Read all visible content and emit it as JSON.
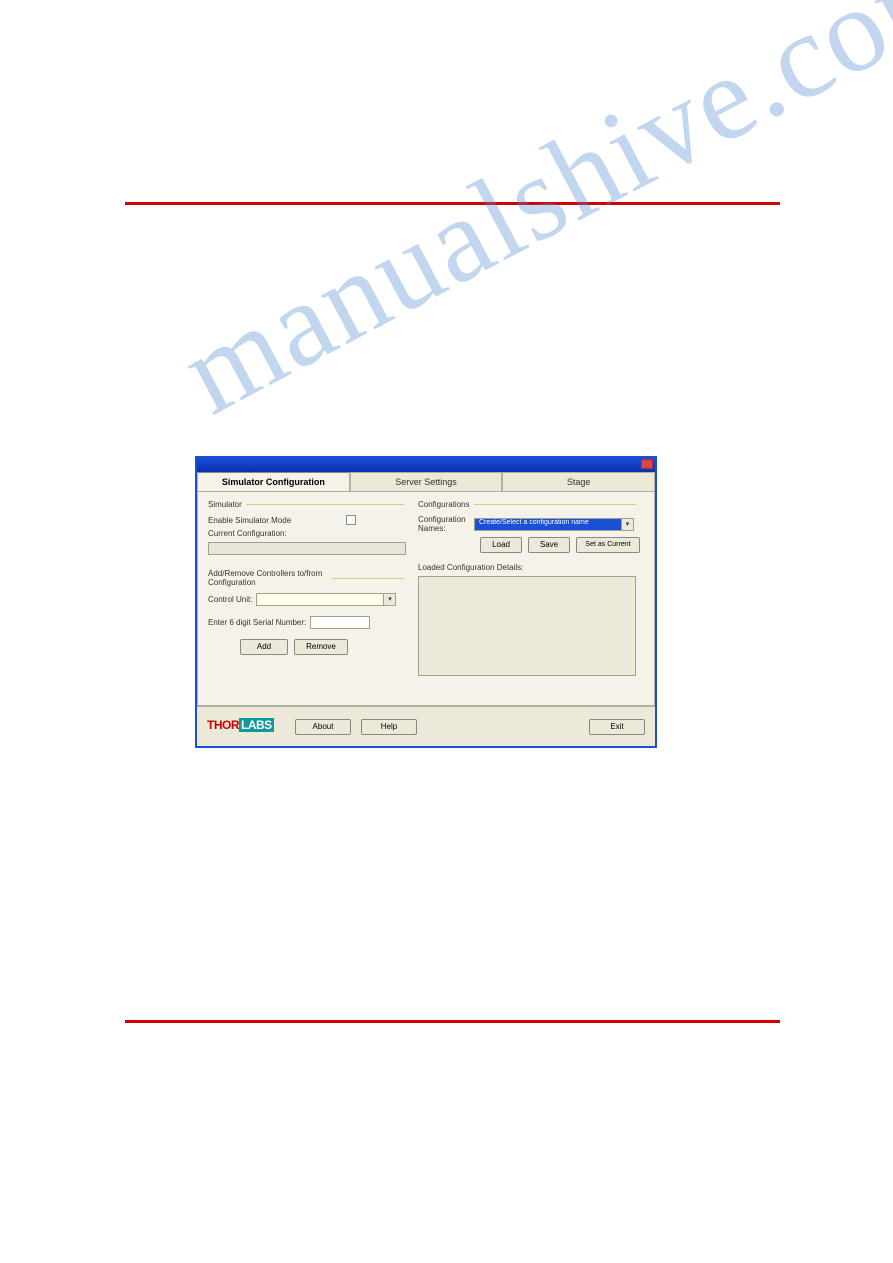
{
  "watermark": "manualshive.com",
  "window": {
    "tabs": [
      "Simulator Configuration",
      "Server Settings",
      "Stage"
    ],
    "active_tab": 0,
    "simulator": {
      "group_label": "Simulator",
      "enable_label": "Enable Simulator Mode",
      "enable_checked": false,
      "current_label": "Current Configuration:",
      "current_value": ""
    },
    "addremove": {
      "group_label": "Add/Remove Controllers to/from Configuration",
      "control_unit_label": "Control Unit:",
      "control_unit_value": "",
      "serial_label": "Enter 6 digit Serial Number:",
      "serial_value": "",
      "add_btn": "Add",
      "remove_btn": "Remove"
    },
    "configurations": {
      "group_label": "Configurations",
      "names_label": "Configuration Names:",
      "names_value": "Create/Select a configuration name",
      "load_btn": "Load",
      "save_btn": "Save",
      "set_btn": "Set as Current",
      "details_label": "Loaded Configuration Details:"
    },
    "footer": {
      "logo_a": "THOR",
      "logo_b": "LABS",
      "about_btn": "About",
      "help_btn": "Help",
      "exit_btn": "Exit"
    }
  }
}
